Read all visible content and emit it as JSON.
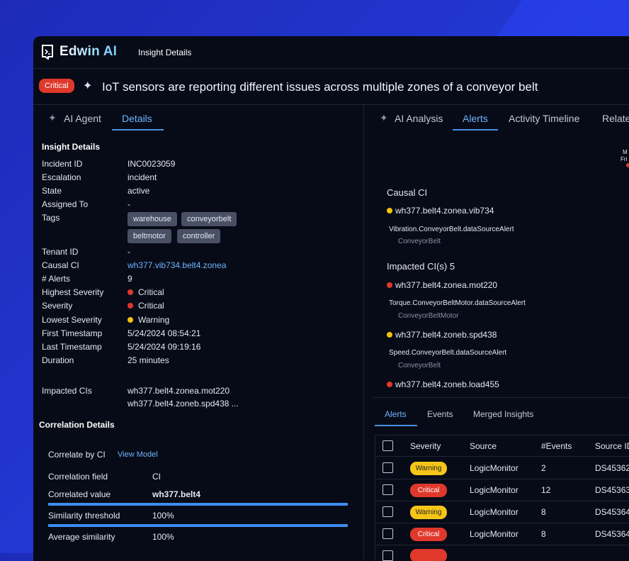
{
  "app": {
    "name": "Edwin AI",
    "page_label": "Insight Details"
  },
  "insight": {
    "badge": "Critical",
    "title": "IoT sensors are reporting different issues across multiple zones of a conveyor belt"
  },
  "left_tabs": [
    {
      "label": "AI Agent"
    },
    {
      "label": "Details"
    }
  ],
  "details": {
    "section_title": "Insight Details",
    "rows": [
      {
        "label": "Incident ID",
        "value": "INC0023059"
      },
      {
        "label": "Escalation",
        "value": "incident"
      },
      {
        "label": "State",
        "value": "active"
      },
      {
        "label": "Assigned To",
        "value": "-"
      },
      {
        "label": "Tags",
        "value": ""
      },
      {
        "label": "Tenant ID",
        "value": "-"
      },
      {
        "label": "Causal CI",
        "value": "wh377.vib734.belt4.zonea"
      },
      {
        "label": "# Alerts",
        "value": "9"
      },
      {
        "label": "Highest Severity",
        "value": "Critical"
      },
      {
        "label": "Severity",
        "value": "Critical"
      },
      {
        "label": "Lowest Severity",
        "value": "Warning"
      },
      {
        "label": "First Timestamp",
        "value": "5/24/2024 08:54:21"
      },
      {
        "label": "Last Timestamp",
        "value": "5/24/2024 09:19:16"
      },
      {
        "label": "Duration",
        "value": "25 minutes"
      }
    ],
    "tags": [
      "warehouse",
      "conveyorbelt",
      "beltmotor",
      "controller"
    ],
    "impacted_label": "Impacted CIs",
    "impacted": [
      "wh377.belt4.zonea.mot220",
      "wh377.belt4.zoneb.spd438 ..."
    ]
  },
  "correlation": {
    "section_title": "Correlation Details",
    "by_label": "Correlate by CI",
    "view_model": "View Model",
    "rows": [
      {
        "label": "Correlation field",
        "value": "CI"
      },
      {
        "label": "Correlated value",
        "value": "wh377.belt4"
      },
      {
        "label": "Similarity threshold",
        "value": "100%"
      },
      {
        "label": "Average similarity",
        "value": "100%"
      }
    ]
  },
  "right_tabs": [
    {
      "label": "AI Analysis"
    },
    {
      "label": "Alerts"
    },
    {
      "label": "Activity Timeline"
    },
    {
      "label": "Relate"
    }
  ],
  "graph_clip": {
    "line1": "M",
    "line2": "Fri"
  },
  "analysis": {
    "causal_title": "Causal CI",
    "causal": {
      "ci": "wh377.belt4.zonea.vib734",
      "alert": "Vibration.ConveyorBelt.dataSourceAlert",
      "type": "ConveyorBelt"
    },
    "impacted_title": "Impacted CI(s) 5",
    "impacted": [
      {
        "ci": "wh377.belt4.zonea.mot220",
        "alert": "Torque.ConveyorBeltMotor.dataSourceAlert",
        "type": "ConveyorBeltMotor"
      },
      {
        "ci": "wh377.belt4.zoneb.spd438",
        "alert": "Speed.ConveyorBelt.dataSourceAlert",
        "type": "ConveyorBelt"
      },
      {
        "ci": "wh377.belt4.zoneb.load455"
      }
    ]
  },
  "alerts_tabs": [
    {
      "label": "Alerts"
    },
    {
      "label": "Events"
    },
    {
      "label": "Merged Insights"
    }
  ],
  "alerts_table": {
    "headers": [
      "Severity",
      "Source",
      "#Events",
      "Source ID"
    ],
    "rows": [
      {
        "severity": "Warning",
        "source": "LogicMonitor",
        "events": "2",
        "source_id": "DS45362"
      },
      {
        "severity": "Critical",
        "source": "LogicMonitor",
        "events": "12",
        "source_id": "DS45363"
      },
      {
        "severity": "Warning",
        "source": "LogicMonitor",
        "events": "8",
        "source_id": "DS45364"
      },
      {
        "severity": "Critical",
        "source": "LogicMonitor",
        "events": "8",
        "source_id": "DS45364"
      }
    ]
  },
  "colors": {
    "critical": "#e0382b",
    "warning": "#f2c20b",
    "accent": "#4a90e2",
    "background": "#070b17"
  }
}
